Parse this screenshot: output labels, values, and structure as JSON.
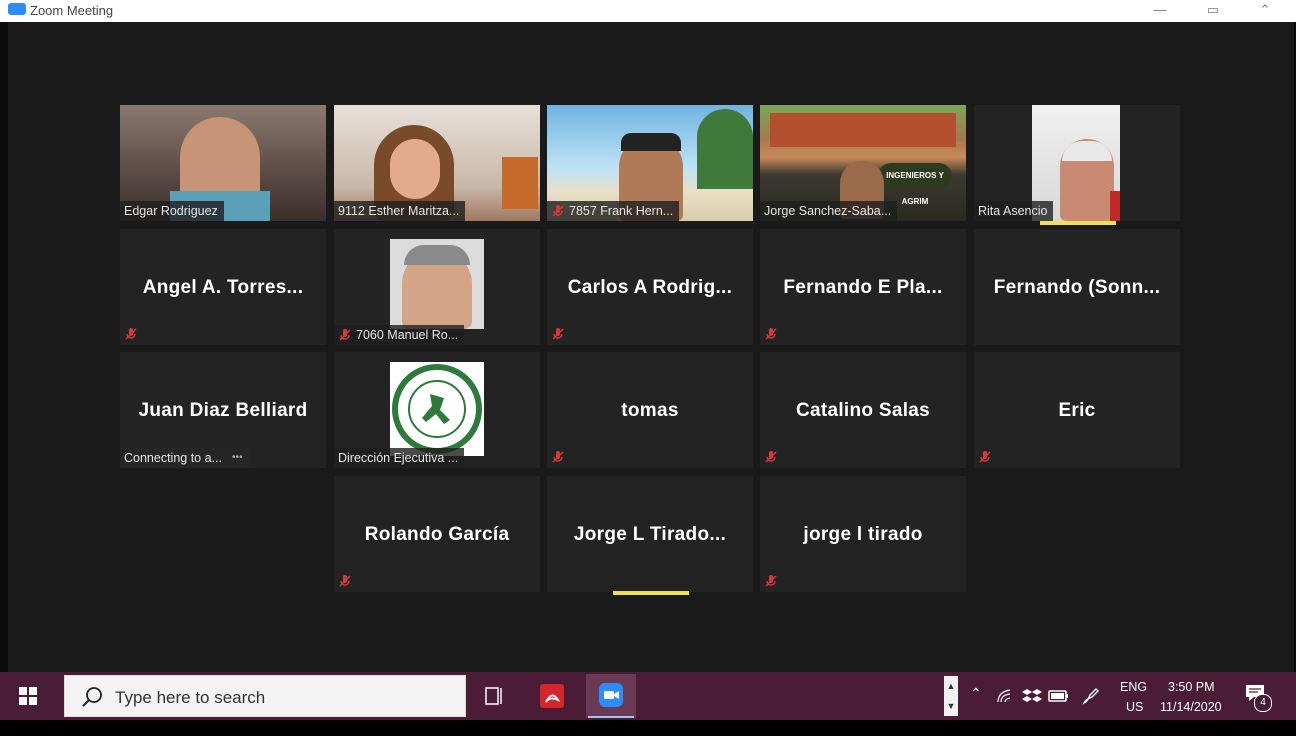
{
  "window": {
    "title": "Zoom Meeting"
  },
  "participants": [
    {
      "label": "Edgar Rodriguez",
      "muted": false
    },
    {
      "label": "9112 Esther Maritza...",
      "muted": false
    },
    {
      "label": "7857 Frank Hern...",
      "muted": true
    },
    {
      "label": "Jorge Sanchez-Saba...",
      "muted": false,
      "active": true,
      "sign_text": "INGENIEROS Y AGRIM"
    },
    {
      "label": "Rita Asencio",
      "muted": false,
      "speaking": true
    },
    {
      "name": "Angel A. Torres...",
      "muted": true
    },
    {
      "label": "7060 Manuel Ro...",
      "muted": true
    },
    {
      "name": "Carlos A Rodrig...",
      "muted": true
    },
    {
      "name": "Fernando E Pla...",
      "muted": true
    },
    {
      "name": "Fernando (Sonn...",
      "muted": false
    },
    {
      "name": "Juan Diaz Belliard",
      "status": "Connecting to a...",
      "muted": false
    },
    {
      "label": "Dirección Ejecutiva ...",
      "muted": false
    },
    {
      "name": "tomas",
      "muted": true
    },
    {
      "name": "Catalino Salas",
      "muted": true
    },
    {
      "name": "Eric",
      "muted": true
    },
    {
      "name": "Rolando García",
      "muted": true
    },
    {
      "name": "Jorge  L Tirado...",
      "muted": false,
      "speaking": true
    },
    {
      "name": "jorge l tirado",
      "muted": true
    }
  ],
  "taskbar": {
    "search_placeholder": "Type here to search",
    "language": "ENG",
    "region": "US",
    "time": "3:50 PM",
    "date": "11/14/2020",
    "notification_count": "4"
  },
  "colors": {
    "active_speaker_outline": "#b5df3a",
    "speaking_bar": "#f0e060",
    "mute_red": "#d9383a",
    "taskbar": "#4a1c36",
    "zoom_blue": "#2d8cff"
  }
}
